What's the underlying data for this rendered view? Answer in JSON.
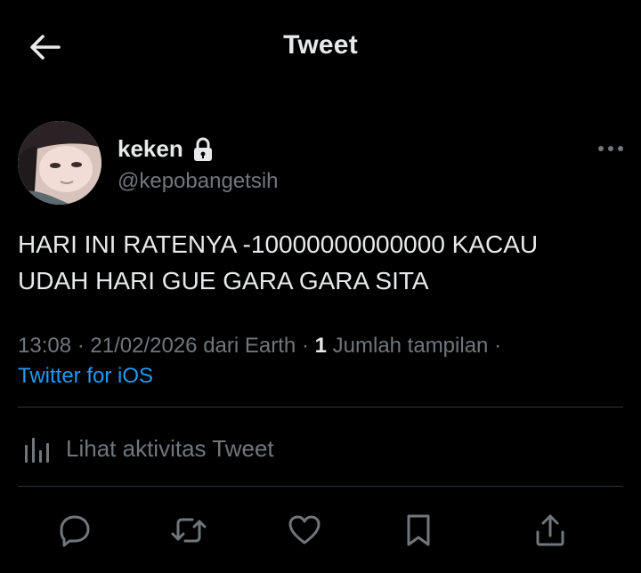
{
  "header": {
    "title": "Tweet",
    "back_icon": "arrow-left-icon"
  },
  "author": {
    "name": "keken",
    "handle": "@kepobangetsih",
    "lock_icon": "lock-icon",
    "more_icon": "more-horizontal-icon"
  },
  "tweet": {
    "text_line1": "HARI INI RATENYA -10000000000000 KACAU",
    "text_line2": "UDAH HARI GUE GARA GARA SITA"
  },
  "meta": {
    "time": "13:08",
    "sep1": "·",
    "date": "21/02/2026",
    "location": "dari Earth",
    "sep2": "·",
    "views_count": "1",
    "views_label": "Jumlah tampilan",
    "sep3": "·",
    "source": "Twitter for iOS"
  },
  "activity": {
    "label": "Lihat aktivitas Tweet",
    "icon": "analytics-icon"
  },
  "actions": {
    "reply_icon": "reply-icon",
    "retweet_icon": "retweet-icon",
    "like_icon": "heart-icon",
    "bookmark_icon": "bookmark-icon",
    "share_icon": "share-icon"
  },
  "colors": {
    "background": "#000000",
    "text": "#e7e9ea",
    "secondary": "#71767b",
    "link": "#1d9bf0",
    "divider": "#2f3336"
  }
}
